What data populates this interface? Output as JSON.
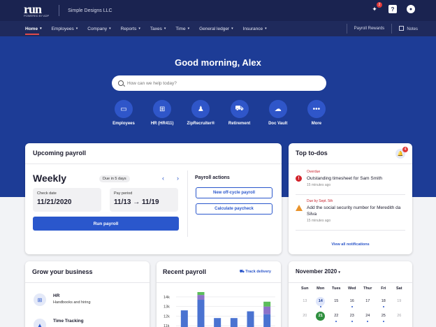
{
  "app": {
    "logo_text": "run",
    "logo_sub": "POWERED BY ADP",
    "company": "Simple Designs LLC",
    "help_badge": "2"
  },
  "nav": {
    "items": [
      {
        "label": "Home"
      },
      {
        "label": "Employees"
      },
      {
        "label": "Company"
      },
      {
        "label": "Reports"
      },
      {
        "label": "Taxes"
      },
      {
        "label": "Time"
      },
      {
        "label": "General ledger"
      },
      {
        "label": "Insurance"
      }
    ],
    "payroll_rewards": "Payroll Rewards",
    "notes": "Notes"
  },
  "hero": {
    "greeting": "Good morning, Alex",
    "search_placeholder": "How can we help today?",
    "actions": [
      {
        "label": "Employees",
        "icon": "id-card-icon"
      },
      {
        "label": "HR (HR411)",
        "icon": "hr-icon"
      },
      {
        "label": "ZipRecruiter®",
        "icon": "zip-icon"
      },
      {
        "label": "Retirement",
        "icon": "retirement-icon"
      },
      {
        "label": "Doc Vault",
        "icon": "cloud-icon"
      },
      {
        "label": "More",
        "icon": "more-icon"
      }
    ]
  },
  "upcoming_payroll": {
    "title": "Upcoming payroll",
    "frequency": "Weekly",
    "due": "Due in 5 days",
    "check_date_label": "Check date",
    "check_date": "11/21/2020",
    "pay_period_label": "Pay period",
    "pay_period": "11/13 → 11/19",
    "run_button": "Run payroll",
    "actions_title": "Payroll actions",
    "off_cycle": "New off-cycle payroll",
    "calc_paycheck": "Calculate paycheck"
  },
  "todos": {
    "title": "Top to-dos",
    "badge": "4",
    "items": [
      {
        "status": "Overdue",
        "text": "Outstanding timesheet for Sam Smith",
        "time": "15 minutes ago",
        "kind": "error"
      },
      {
        "status": "Due by Sept. 5th",
        "text": "Add the social security number for Meredith da Silva",
        "time": "15 minutes ago",
        "kind": "warning"
      }
    ],
    "view_all": "View all notifications"
  },
  "grow": {
    "title": "Grow your business",
    "items": [
      {
        "title": "HR",
        "subtitle": "Handbooks and hiring"
      },
      {
        "title": "Time Tracking",
        "subtitle": ""
      }
    ]
  },
  "recent_payroll": {
    "title": "Recent payroll",
    "track": "Track delivery"
  },
  "chart_data": {
    "type": "bar",
    "title": "",
    "xlabel": "",
    "ylabel": "",
    "y_tick_labels": [
      "14k",
      "13k",
      "12k",
      "11k"
    ],
    "ylim": [
      10,
      14.5
    ],
    "series": [
      {
        "values": [
          12.6,
          13.7,
          11.8,
          11.8,
          12.5,
          12.2
        ]
      },
      {
        "values": [
          0,
          0.5,
          0,
          0,
          0,
          0.8
        ]
      },
      {
        "values": [
          0,
          0.3,
          0,
          0,
          0,
          0.5
        ]
      }
    ],
    "colors": [
      "#4a73d1",
      "#8c72c9",
      "#5bbd5a"
    ],
    "grid": true
  },
  "calendar": {
    "month": "November 2020",
    "days_of_week": [
      "Sun",
      "Mon",
      "Tues",
      "Wed",
      "Thur",
      "Fri",
      "Sat"
    ],
    "week1": [
      {
        "d": "13",
        "muted": true
      },
      {
        "d": "14",
        "today": true,
        "dot": true
      },
      {
        "d": "15",
        "dot": false
      },
      {
        "d": "16",
        "dot": true
      },
      {
        "d": "17"
      },
      {
        "d": "18",
        "dot": true
      },
      {
        "d": "19",
        "muted": true
      }
    ],
    "week2": [
      {
        "d": "20",
        "muted": true
      },
      {
        "d": "21",
        "sel": true
      },
      {
        "d": "22",
        "dot": true
      },
      {
        "d": "23",
        "dot": true
      },
      {
        "d": "24",
        "dot": true
      },
      {
        "d": "25",
        "dot": true
      },
      {
        "d": "26",
        "muted": true
      }
    ]
  }
}
